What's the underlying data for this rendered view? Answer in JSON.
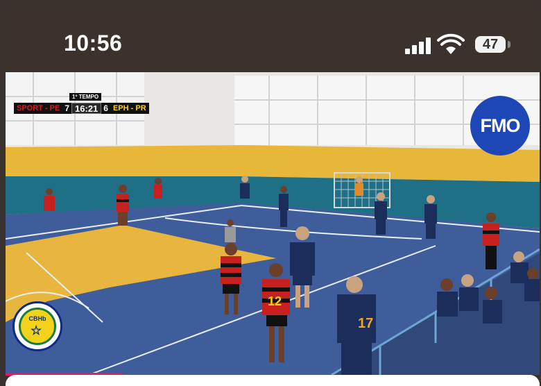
{
  "status_bar": {
    "time": "10:56",
    "battery": "47",
    "icons": [
      "cellular-signal-icon",
      "wifi-icon",
      "battery-icon"
    ]
  },
  "video": {
    "scoreboard": {
      "period": "1º TEMPO",
      "home_team": "SPORT - PE",
      "home_score": "7",
      "clock": "16:21",
      "away_score": "6",
      "away_team": "EPH - PR"
    },
    "logo_right": "FMO",
    "logo_left": "CBHb",
    "jersey_numbers": [
      "12",
      "17"
    ]
  },
  "progress": {
    "fraction": 0.22,
    "color": "#e21d5a"
  }
}
